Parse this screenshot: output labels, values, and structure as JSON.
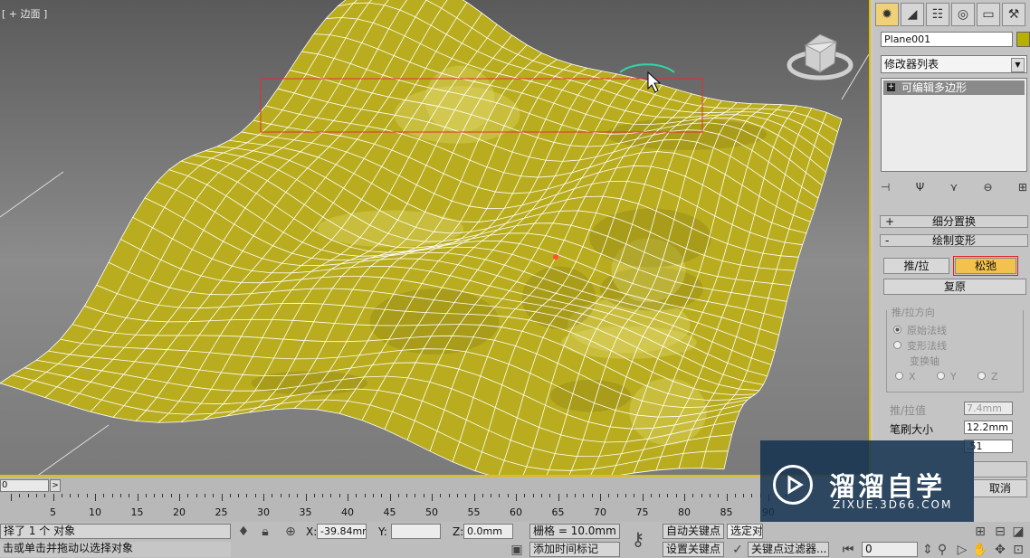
{
  "viewport": {
    "label": "[ + 边面 ]",
    "mesh_color": "#b9ad1f",
    "wire_color": "#ffffff",
    "selection_color": "#ff3030"
  },
  "panel": {
    "object_name": "Plane001",
    "modifier_list": "修改器列表",
    "stack_item": "可编辑多边形",
    "rollouts": {
      "subdivision": "细分置换",
      "paint_deform": "绘制变形"
    },
    "buttons": {
      "push_pull": "推/拉",
      "relax": "松弛",
      "revert": "复原"
    },
    "push_direction": {
      "title": "推/拉方向",
      "original_normals": "原始法线",
      "deformed_normals": "变形法线",
      "transform_axis": "变换轴",
      "x": "X",
      "y": "Y",
      "z": "Z"
    },
    "params": {
      "push_value_label": "推/拉值",
      "push_value": "7.4mm",
      "brush_size_label": "笔刷大小",
      "brush_size": "12.2mm",
      "brush_strength": ".51"
    },
    "cancel": "取消"
  },
  "timeline": {
    "frame": "0",
    "frame_arrow": ">",
    "ticks": [
      "5",
      "10",
      "15",
      "20",
      "25",
      "30",
      "35",
      "40",
      "45",
      "50",
      "55",
      "60",
      "65",
      "70",
      "75",
      "80",
      "85",
      "90"
    ]
  },
  "status": {
    "selected": "择了 1 个 对象",
    "prompt": "击或单击并拖动以选择对象",
    "x_label": "X:",
    "x_value": "-39.84mm",
    "y_label": "Y:",
    "y_value": "",
    "z_label": "Z:",
    "z_value": "0.0mm",
    "grid": "栅格 = 10.0mm",
    "add_time_tag": "添加时间标记",
    "auto_key": "自动关键点",
    "set_key": "设置关键点",
    "selected_obj": "选定对",
    "key_filters": "关键点过滤器...",
    "frame_field": "0"
  },
  "logo": {
    "title": "溜溜自学",
    "url": "ZIXUE.3D66.COM"
  }
}
